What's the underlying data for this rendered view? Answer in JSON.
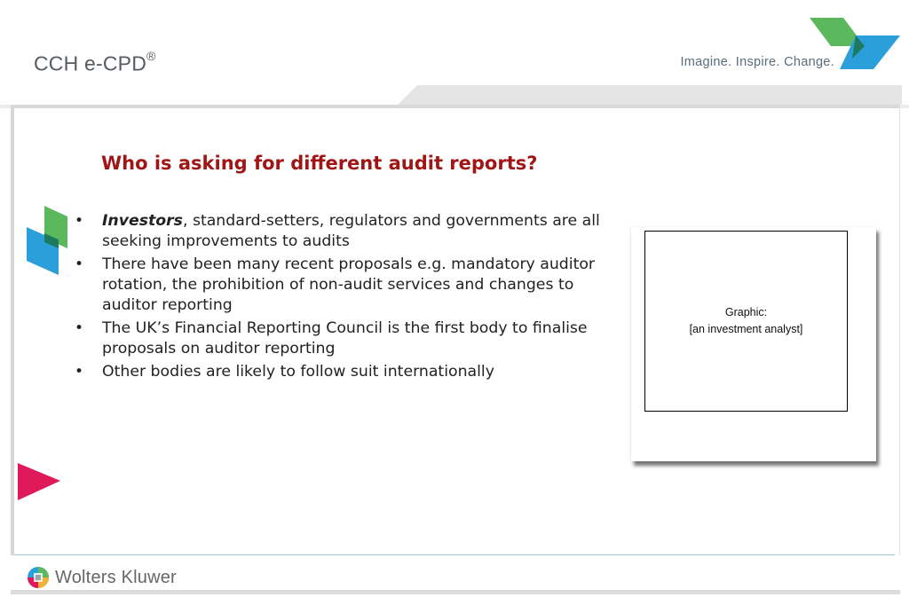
{
  "header": {
    "brand": "CCH e-CPD",
    "brand_mark": "®",
    "tagline": "Imagine. Inspire. Change."
  },
  "slide": {
    "title": "Who is asking for different audit reports?",
    "bullets": [
      {
        "emphasis": "Investors",
        "text": ", standard-setters, regulators and governments are all seeking improvements to audits"
      },
      {
        "emphasis": "",
        "text": "There have been many recent proposals e.g. mandatory auditor rotation, the prohibition of non-audit services and changes to auditor reporting"
      },
      {
        "emphasis": "",
        "text": "The UK’s Financial Reporting Council is the first body to finalise proposals on auditor reporting"
      },
      {
        "emphasis": "",
        "text": "Other bodies are likely to follow suit internationally"
      }
    ],
    "graphic": {
      "line1": "Graphic:",
      "line2": "[an investment analyst]"
    }
  },
  "footer": {
    "company": "Wolters Kluwer",
    "logo_icon": "wolters-kluwer-globe-icon"
  },
  "colors": {
    "title": "#a01515",
    "accent_green": "#5cb85c",
    "accent_blue": "#2b9fd9",
    "accent_pink": "#e0195a",
    "frame_rule": "#9fc6d6"
  }
}
